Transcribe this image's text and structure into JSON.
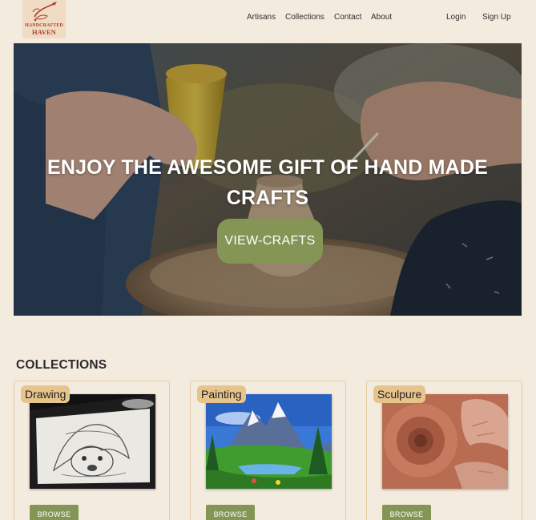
{
  "brand": {
    "logo_line1": "HANDCRAFTED",
    "logo_line2": "HAVEN",
    "accent": "#a8412a"
  },
  "nav": {
    "items": [
      "Artisans",
      "Collections",
      "Contact",
      "About"
    ],
    "login": "Login",
    "signup": "Sign Up"
  },
  "hero": {
    "title_line1": "ENJOY THE AWESOME GIFT OF HAND MADE",
    "title_line2": "CRAFTS",
    "button": "VIEW-CRAFTS",
    "button_color": "#849556"
  },
  "collections": {
    "title": "COLLECTIONS",
    "cards": [
      {
        "tag": "Drawing",
        "image": "pencil-sketch-puppy-image",
        "button": "BROWSE"
      },
      {
        "tag": "Painting",
        "image": "mountain-landscape-painting-image",
        "button": "BROWSE"
      },
      {
        "tag": "Sculpure",
        "image": "pottery-wheel-clay-image",
        "button": "BROWSE"
      }
    ]
  },
  "colors": {
    "background": "#f4ebdf",
    "tag": "#e6c48c",
    "card_border": "#e4c9a2"
  }
}
